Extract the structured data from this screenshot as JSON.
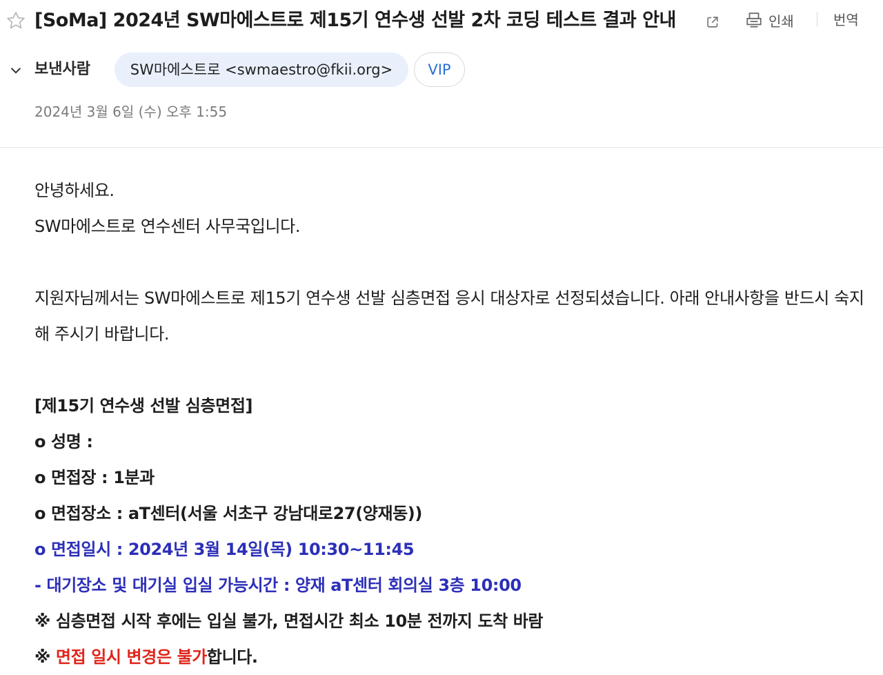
{
  "header": {
    "subject": "[SoMa] 2024년 SW마에스트로 제15기 연수생 선발 2차 코딩 테스트 결과 안내",
    "print_label": "인쇄",
    "translate_label": "번역",
    "icons": [
      "star-icon",
      "popout-icon",
      "print-icon",
      "chevron-down-icon"
    ]
  },
  "sender": {
    "label": "보낸사람",
    "address": "SW마에스트로 <swmaestro@fkii.org>",
    "vip_label": "VIP",
    "date": "2024년 3월 6일 (수) 오후 1:55"
  },
  "body": {
    "greeting": "안녕하세요.",
    "org_intro": "SW마에스트로 연수센터 사무국입니다.",
    "notice": "지원자님께서는 SW마에스트로 제15기 연수생 선발 심층면접 응시 대상자로 선정되셨습니다. 아래 안내사항을 반드시 숙지해 주시기 바랍니다.",
    "section_title": "[제15기 연수생 선발 심층면접]",
    "name_line": "o 성명 :",
    "room_line": "o 면접장 : 1분과",
    "place_line": "o 면접장소 : aT센터(서울 서초구 강남대로27(양재동))",
    "time_line": "o 면접일시 : 2024년 3월 14일(목) 10:30~11:45",
    "waiting_line": "- 대기장소 및 대기실 입실 가능시간 : 양재 aT센터 회의실 3층  10:00",
    "warning_line": "※ 심층면접 시작 후에는 입실 불가, 면접시간 최소 10분 전까지 도착 바람",
    "final_prefix": "※ ",
    "final_red": "면접 일시 변경은 불가",
    "final_suffix": "합니다."
  },
  "colors": {
    "chip_bg": "#e9f0fc",
    "vip_text": "#2b6fd6",
    "emphasis_blue": "#2c2fb8",
    "emphasis_red": "#e0251b"
  }
}
